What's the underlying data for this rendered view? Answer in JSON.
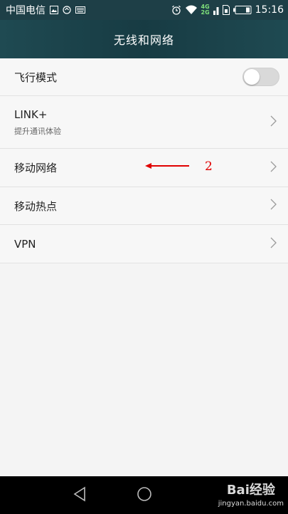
{
  "status_bar": {
    "carrier": "中国电信",
    "network_top": "4G",
    "network_bottom": "2G",
    "time": "15:16",
    "icons": [
      "image-icon",
      "sync-icon",
      "keyboard-icon",
      "alarm-icon",
      "wifi-icon",
      "signal-icon",
      "sim-icon",
      "battery-icon"
    ]
  },
  "header": {
    "title": "无线和网络"
  },
  "settings": {
    "airplane": {
      "label": "飞行模式",
      "toggle_on": false
    },
    "link_plus": {
      "label": "LINK+",
      "subtitle": "提升通讯体验"
    },
    "mobile_network": {
      "label": "移动网络"
    },
    "hotspot": {
      "label": "移动热点"
    },
    "vpn": {
      "label": "VPN"
    }
  },
  "annotation": {
    "label": "2",
    "color": "#e00000"
  },
  "nav_bar": {
    "buttons": [
      "back-icon",
      "home-icon"
    ]
  },
  "watermark": {
    "logo": "Bai经验",
    "url": "jingyan.baidu.com"
  },
  "colors": {
    "header_bg": "#1e3f47",
    "background": "#f4f4f4",
    "annotation": "#e00000"
  }
}
